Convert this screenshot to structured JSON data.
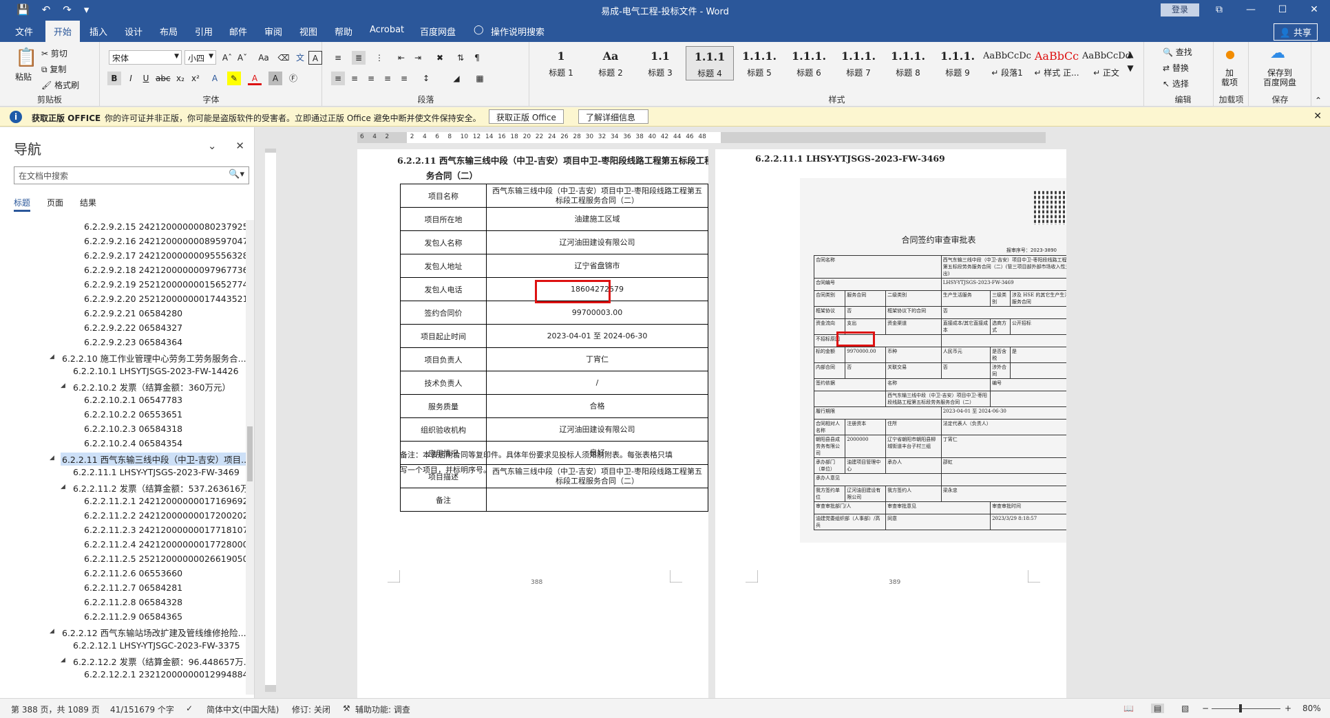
{
  "window": {
    "title": "易成-电气工程-投标文件 - Word",
    "login": "登录",
    "buttons": [
      "⧉",
      "—",
      "☐",
      "✕"
    ]
  },
  "quick_access": [
    "save-icon",
    "undo-icon",
    "redo-icon",
    "customize-icon"
  ],
  "tabs": [
    "文件",
    "开始",
    "插入",
    "设计",
    "布局",
    "引用",
    "邮件",
    "审阅",
    "视图",
    "帮助",
    "Acrobat",
    "百度网盘"
  ],
  "active_tab": "开始",
  "tell_me": "操作说明搜索",
  "share": "共享",
  "ribbon": {
    "clipboard": {
      "label": "剪贴板",
      "paste": "粘贴",
      "cut": "剪切",
      "copy": "复制",
      "format_painter": "格式刷"
    },
    "font": {
      "label": "字体",
      "name": "宋体",
      "size": "小四",
      "case": "Aa"
    },
    "paragraph": {
      "label": "段落"
    },
    "styles": {
      "label": "样式",
      "items": [
        {
          "sample": "1",
          "name": "标题 1"
        },
        {
          "sample": "Aa",
          "name": "标题 2"
        },
        {
          "sample": "1.1",
          "name": "标题 3"
        },
        {
          "sample": "1.1.1",
          "name": "标题 4"
        },
        {
          "sample": "1.1.1.",
          "name": "标题 5"
        },
        {
          "sample": "1.1.1.",
          "name": "标题 6"
        },
        {
          "sample": "1.1.1.",
          "name": "标题 7"
        },
        {
          "sample": "1.1.1.",
          "name": "标题 8"
        },
        {
          "sample": "1.1.1.",
          "name": "标题 9"
        },
        {
          "sample": "AaBbCcDc",
          "name": "↵ 段落1"
        },
        {
          "sample": "AaBbCc",
          "name": "↵ 样式 正..."
        },
        {
          "sample": "AaBbCcDdI",
          "name": "↵ 正文"
        }
      ],
      "selected_index": 3
    },
    "editing": {
      "label": "编辑",
      "find": "查找",
      "replace": "替换",
      "select": "选择"
    },
    "addins": {
      "label": "加载项",
      "btn": "加\n载项"
    },
    "save": {
      "label": "保存",
      "btn": "保存到\n百度网盘"
    }
  },
  "message_bar": {
    "title": "获取正版 OFFICE",
    "text": "你的许可证并非正版，你可能是盗版软件的受害者。立即通过正版 Office 避免中断并使文件保持安全。",
    "btn1": "获取正版 Office",
    "btn2": "了解详细信息"
  },
  "nav": {
    "title": "导航",
    "search_placeholder": "在文档中搜索",
    "tabs": [
      "标题",
      "页面",
      "结果"
    ],
    "items": [
      {
        "level": 3,
        "text": "6.2.2.9.2.15 24212000000080237925"
      },
      {
        "level": 3,
        "text": "6.2.2.9.2.16 24212000000089597047"
      },
      {
        "level": 3,
        "text": "6.2.2.9.2.17 24212000000095556328"
      },
      {
        "level": 3,
        "text": "6.2.2.9.2.18 24212000000097967736"
      },
      {
        "level": 3,
        "text": "6.2.2.9.2.19 25212000000015652774"
      },
      {
        "level": 3,
        "text": "6.2.2.9.2.20 25212000000017443521"
      },
      {
        "level": 3,
        "text": "6.2.2.9.2.21 06584280"
      },
      {
        "level": 3,
        "text": "6.2.2.9.2.22 06584327"
      },
      {
        "level": 3,
        "text": "6.2.2.9.2.23 06584364"
      },
      {
        "level": 0,
        "arrow": "◢",
        "text": "6.2.2.10 施工作业管理中心劳务工劳务服务合..."
      },
      {
        "level": 1,
        "text": "6.2.2.10.1 LHSYTJSGS-2023-FW-14426"
      },
      {
        "level": 1,
        "arrow": "◢",
        "text": "6.2.2.10.2 发票（结算金额：360万元）"
      },
      {
        "level": 2,
        "text": "6.2.2.10.2.1 06547783"
      },
      {
        "level": 2,
        "text": "6.2.2.10.2.2 06553651"
      },
      {
        "level": 2,
        "text": "6.2.2.10.2.3 06584318"
      },
      {
        "level": 2,
        "text": "6.2.2.10.2.4 06584354"
      },
      {
        "level": 0,
        "arrow": "◢",
        "text": "6.2.2.11 西气东输三线中段（中卫-吉安）项目...",
        "selected": true
      },
      {
        "level": 1,
        "text": "6.2.2.11.1 LHSY-YTJSGS-2023-FW-3469"
      },
      {
        "level": 1,
        "arrow": "◢",
        "text": "6.2.2.11.2 发票（结算金额：537.263616万..."
      },
      {
        "level": 2,
        "text": "6.2.2.11.2.1 24212000000017169692"
      },
      {
        "level": 2,
        "text": "6.2.2.11.2.2 24212000000017200202"
      },
      {
        "level": 2,
        "text": "6.2.2.11.2.3 24212000000017718107"
      },
      {
        "level": 2,
        "text": "6.2.2.11.2.4 24212000000017728000"
      },
      {
        "level": 2,
        "text": "6.2.2.11.2.5 25212000000026619050"
      },
      {
        "level": 2,
        "text": "6.2.2.11.2.6 06553660"
      },
      {
        "level": 2,
        "text": "6.2.2.11.2.7 06584281"
      },
      {
        "level": 2,
        "text": "6.2.2.11.2.8 06584328"
      },
      {
        "level": 2,
        "text": "6.2.2.11.2.9 06584365"
      },
      {
        "level": 0,
        "arrow": "◢",
        "text": "6.2.2.12 西气东输站场改扩建及管线维修抢险..."
      },
      {
        "level": 1,
        "text": "6.2.2.12.1 LHSY-YTJSGC-2023-FW-3375"
      },
      {
        "level": 1,
        "arrow": "◢",
        "text": "6.2.2.12.2 发票（结算金额：96.448657万..."
      },
      {
        "level": 2,
        "text": "6.2.2.12.2.1 23212000000012994884"
      }
    ]
  },
  "page388": {
    "heading_line1": "6.2.2.11 西气东输三线中段（中卫-吉安）项目中卫-枣阳段线路工程第五标段工程服",
    "heading_line2": "务合同（二）",
    "rows": [
      {
        "k": "项目名称",
        "v": "西气东输三线中段（中卫-吉安）项目中卫-枣阳段线路工程第五标段工程服务合同（二）"
      },
      {
        "k": "项目所在地",
        "v": "油建施工区域"
      },
      {
        "k": "发包人名称",
        "v": "辽河油田建设有限公司"
      },
      {
        "k": "发包人地址",
        "v": "辽宁省盘锦市"
      },
      {
        "k": "发包人电话",
        "v": "18604272579"
      },
      {
        "k": "签约合同价",
        "v": "99700003.00"
      },
      {
        "k": "项目起止时间",
        "v": "2023-04-01 至 2024-06-30"
      },
      {
        "k": "项目负责人",
        "v": "丁宵仁"
      },
      {
        "k": "技术负责人",
        "v": "/"
      },
      {
        "k": "服务质量",
        "v": "合格"
      },
      {
        "k": "组织验收机构",
        "v": "辽河油田建设有限公司"
      },
      {
        "k": "应用情况",
        "v": "良好"
      },
      {
        "k": "项目描述",
        "v": "西气东输三线中段（中卫-吉安）项目中卫-枣阳段线路工程第五标段工程服务合同（二）"
      },
      {
        "k": "备注",
        "v": ""
      }
    ],
    "note": "备注：本表后附合同等复印件。具体年份要求见投标人须知前附表。每张表格只填写一个项目，并标明序号。",
    "page_no": "388"
  },
  "page389": {
    "heading": "6.2.2.11.1 LHSY-YTJSGS-2023-FW-3469",
    "form_title": "合同签约审查审批表",
    "form_no": "报审序号：2023-3890",
    "rows": [
      [
        "合同名称",
        "西气东输三线中段（中卫-吉安）项目中卫-枣阳段线路工程第五标段劳务服务合同（二）(管三项目部外部市场收入性支出)"
      ],
      [
        "合同编号",
        "LHSY-YTJSGS-2023-FW-3469"
      ],
      [
        "合同类别",
        "服务合同",
        "二级类别",
        "生产生活服务",
        "三级类别",
        "涉及 HSE 的其它生产生活服务合同"
      ],
      [
        "框架协议",
        "否",
        "框架协议下的合同",
        "否"
      ],
      [
        "资金流向",
        "支出",
        "资金渠道",
        "直接成本/其它直接成本",
        "选商方式",
        "公开招标"
      ],
      [
        "不招标原因",
        ""
      ],
      [
        "标的金额",
        "9970000.00",
        "币种",
        "人民币元",
        "是否含税",
        "是"
      ],
      [
        "内部合同",
        "否",
        "关联交易",
        "否",
        "涉外合同",
        ""
      ],
      [
        "签约依据",
        "名称",
        "编号"
      ],
      [
        "",
        "西气东输三线中段（中卫-吉安）项目中卫-枣阳段线路工程第五标段劳务服务合同（二）",
        ""
      ],
      [
        "履行期限",
        "2023-04-01 至 2024-06-30"
      ],
      [
        "合同相对人名称",
        "注册资本",
        "住所",
        "法定代表人（负责人）"
      ],
      [
        "朝阳县县成劳务有限公司",
        "2000000",
        "辽宁省朝阳市朝阳县柳城街道丰台子村三组",
        "丁宵仁"
      ],
      [
        "承办部门（单位）",
        "油建项目管理中心",
        "承办人",
        "邵虹"
      ],
      [
        "承办人意见",
        ""
      ],
      [
        "我方签约单位",
        "辽河油田建设有限公司",
        "我方签约人",
        "梁永忠"
      ],
      [
        "审查审批部门/人",
        "审查审批意见",
        "审查审批时间"
      ],
      [
        "油建党委组织部（人事部）/高兵",
        "同意",
        "2023/3/29 8:18:57"
      ]
    ],
    "page_no": "389"
  },
  "ruler": {
    "labels": [
      "6",
      "4",
      "2",
      "",
      "2",
      "4",
      "6",
      "8",
      "10",
      "12",
      "14",
      "16",
      "18",
      "20",
      "22",
      "24",
      "26",
      "28",
      "30",
      "32",
      "34",
      "36",
      "38",
      "40",
      "42",
      "44",
      "46",
      "48"
    ]
  },
  "status": {
    "page": "第 388 页，共 1089 页",
    "words": "41/151679 个字",
    "language": "简体中文(中国大陆)",
    "track": "修订: 关闭",
    "accessibility": "辅助功能: 调查",
    "zoom": "80%"
  }
}
